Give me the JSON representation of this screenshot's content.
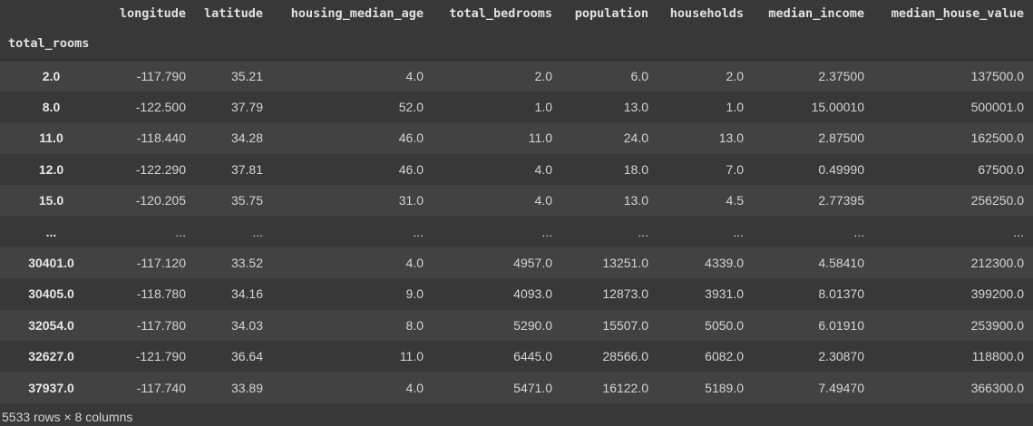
{
  "table": {
    "index_name": "total_rooms",
    "columns": [
      "longitude",
      "latitude",
      "housing_median_age",
      "total_bedrooms",
      "population",
      "households",
      "median_income",
      "median_house_value"
    ],
    "rows": [
      {
        "index": "2.0",
        "cells": [
          "-117.790",
          "35.21",
          "4.0",
          "2.0",
          "6.0",
          "2.0",
          "2.37500",
          "137500.0"
        ]
      },
      {
        "index": "8.0",
        "cells": [
          "-122.500",
          "37.79",
          "52.0",
          "1.0",
          "13.0",
          "1.0",
          "15.00010",
          "500001.0"
        ]
      },
      {
        "index": "11.0",
        "cells": [
          "-118.440",
          "34.28",
          "46.0",
          "11.0",
          "24.0",
          "13.0",
          "2.87500",
          "162500.0"
        ]
      },
      {
        "index": "12.0",
        "cells": [
          "-122.290",
          "37.81",
          "46.0",
          "4.0",
          "18.0",
          "7.0",
          "0.49990",
          "67500.0"
        ]
      },
      {
        "index": "15.0",
        "cells": [
          "-120.205",
          "35.75",
          "31.0",
          "4.0",
          "13.0",
          "4.5",
          "2.77395",
          "256250.0"
        ]
      },
      {
        "index": "...",
        "cells": [
          "...",
          "...",
          "...",
          "...",
          "...",
          "...",
          "...",
          "..."
        ]
      },
      {
        "index": "30401.0",
        "cells": [
          "-117.120",
          "33.52",
          "4.0",
          "4957.0",
          "13251.0",
          "4339.0",
          "4.58410",
          "212300.0"
        ]
      },
      {
        "index": "30405.0",
        "cells": [
          "-118.780",
          "34.16",
          "9.0",
          "4093.0",
          "12873.0",
          "3931.0",
          "8.01370",
          "399200.0"
        ]
      },
      {
        "index": "32054.0",
        "cells": [
          "-117.780",
          "34.03",
          "8.0",
          "5290.0",
          "15507.0",
          "5050.0",
          "6.01910",
          "253900.0"
        ]
      },
      {
        "index": "32627.0",
        "cells": [
          "-121.790",
          "36.64",
          "11.0",
          "6445.0",
          "28566.0",
          "6082.0",
          "2.30870",
          "118800.0"
        ]
      },
      {
        "index": "37937.0",
        "cells": [
          "-117.740",
          "33.89",
          "4.0",
          "5471.0",
          "16122.0",
          "5189.0",
          "7.49470",
          "366300.0"
        ]
      }
    ]
  },
  "footer": {
    "shape_text": "5533 rows × 8 columns"
  },
  "colors": {
    "background": "#383838",
    "row_stripe": "#424242",
    "text": "#d4d4d4"
  }
}
